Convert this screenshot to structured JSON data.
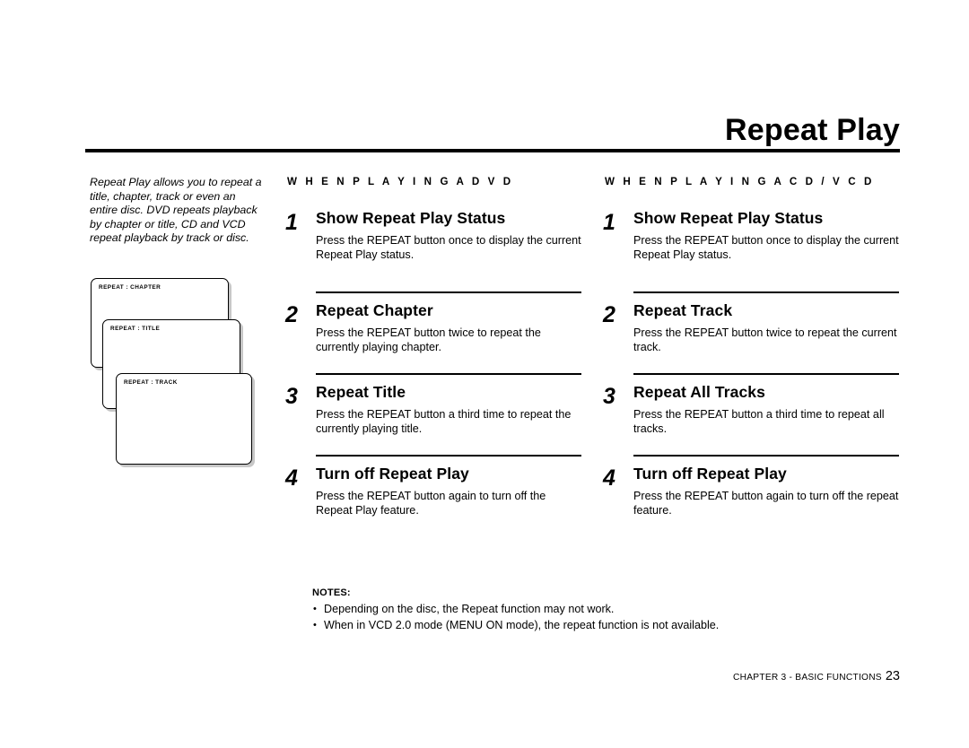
{
  "header": {
    "title": "Repeat Play"
  },
  "sidebar": {
    "intro": "Repeat Play allows you to repeat a title, chapter, track or even an entire disc. DVD repeats playback by chapter or title, CD and VCD repeat playback by track or disc.",
    "osd_boxes": [
      {
        "label": "REPEAT : CHAPTER"
      },
      {
        "label": "REPEAT : TITLE"
      },
      {
        "label": "REPEAT : TRACK"
      }
    ]
  },
  "columns": [
    {
      "heading": "W H E N   P L A Y I N G   A   D V D",
      "steps": [
        {
          "number": "1",
          "title": "Show Repeat Play Status",
          "body": "Press the REPEAT button once to display the current Repeat Play status."
        },
        {
          "number": "2",
          "title": "Repeat Chapter",
          "body": "Press the REPEAT button twice to repeat the currently playing chapter."
        },
        {
          "number": "3",
          "title": "Repeat Title",
          "body": "Press the REPEAT button a third time to repeat the currently playing title."
        },
        {
          "number": "4",
          "title": "Turn off Repeat Play",
          "body": "Press the REPEAT button again to turn off the Repeat Play feature."
        }
      ]
    },
    {
      "heading": "W H E N   P L A Y I N G   A   C D / V C D",
      "steps": [
        {
          "number": "1",
          "title": "Show Repeat Play Status",
          "body": "Press the REPEAT button once to display the current Repeat Play status."
        },
        {
          "number": "2",
          "title": "Repeat Track",
          "body": "Press the REPEAT button twice to repeat the current track."
        },
        {
          "number": "3",
          "title": "Repeat All Tracks",
          "body": "Press the REPEAT button a third time to repeat all tracks."
        },
        {
          "number": "4",
          "title": "Turn off Repeat Play",
          "body": "Press the REPEAT button again to turn off the repeat feature."
        }
      ]
    }
  ],
  "notes": {
    "heading": "NOTES:",
    "bullet": "•",
    "items": [
      "Depending on the disc, the Repeat function may not work.",
      "When in VCD 2.0 mode (MENU ON mode), the repeat function is not available."
    ]
  },
  "footer": {
    "text": "CHAPTER 3 - BASIC FUNCTIONS",
    "page": "23"
  }
}
